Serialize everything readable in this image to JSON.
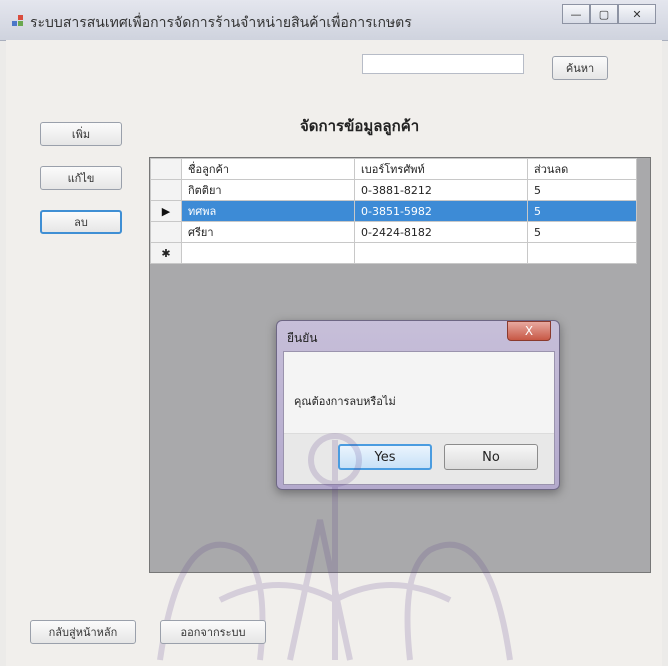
{
  "window": {
    "title": "ระบบสารสนเทศเพื่อการจัดการร้านจำหน่ายสินค้าเพื่อการเกษตร"
  },
  "toolbar": {
    "search_placeholder": "",
    "search_button": "ค้นหา"
  },
  "page": {
    "heading": "จัดการข้อมูลลูกค้า"
  },
  "side_buttons": {
    "add": "เพิ่ม",
    "edit": "แก้ไข",
    "delete": "ลบ"
  },
  "grid": {
    "columns": [
      "ชื่อลูกค้า",
      "เบอร์โทรศัพท์",
      "ส่วนลด"
    ],
    "rows": [
      {
        "indicator": "",
        "cells": [
          "กิตติยา",
          "0-3881-8212",
          "5"
        ]
      },
      {
        "indicator": "▶",
        "cells": [
          "ทศพล",
          "0-3851-5982",
          "5"
        ],
        "selected": true
      },
      {
        "indicator": "",
        "cells": [
          "ศรียา",
          "0-2424-8182",
          "5"
        ]
      },
      {
        "indicator": "✱",
        "cells": [
          "",
          "",
          ""
        ]
      }
    ]
  },
  "dialog": {
    "title": "ยืนยัน",
    "message": "คุณต้องการลบหรือไม่",
    "yes": "Yes",
    "no": "No",
    "close_glyph": "X"
  },
  "footer": {
    "home": "กลับสู่หน้าหลัก",
    "exit": "ออกจากระบบ"
  },
  "colors": {
    "selection": "#3d8bd6",
    "focus": "#3f8fd4"
  }
}
